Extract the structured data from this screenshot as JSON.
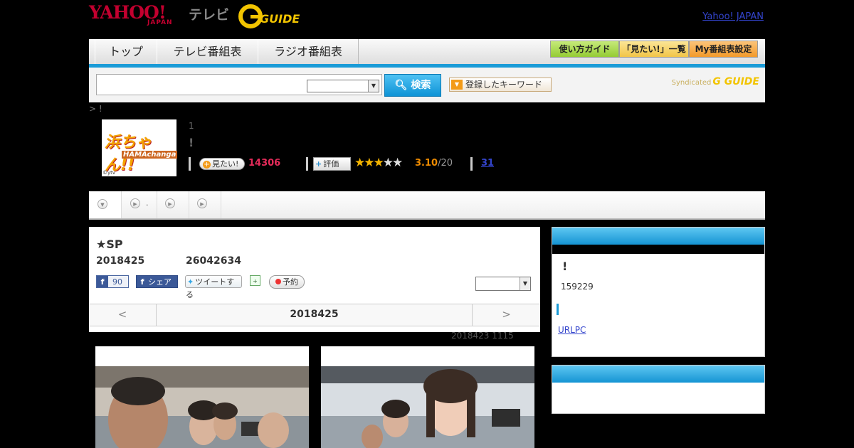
{
  "header": {
    "yahoo_logo": "YAHOO!",
    "yahoo_sub": "JAPAN",
    "tv_label": "テレビ",
    "gguide_logo": "G GUIDE",
    "yahoo_japan_link": "Yahoo! JAPAN"
  },
  "nav": {
    "tabs": [
      {
        "label": "トップ"
      },
      {
        "label": "テレビ番組表"
      },
      {
        "label": "ラジオ番組表"
      }
    ],
    "buttons": [
      {
        "label": "使い方ガイド",
        "color": "#a8d84a"
      },
      {
        "label": "「見たい!」一覧",
        "color": "#f7d060"
      },
      {
        "label": "My番組表設定",
        "color": "#f4a838"
      }
    ]
  },
  "search": {
    "placeholder": "",
    "button_label": "検索",
    "keyword_button": "登録したキーワード",
    "syndicated": "Syndicated",
    "syndicated_logo": "G GUIDE"
  },
  "breadcrumb": "> !",
  "program": {
    "thumb_title": "浜ちゃん!!",
    "thumb_sub": "HAMAchanga",
    "thumb_copyright": "©ytv",
    "number": "1",
    "title": "!",
    "want_label": "見たい!",
    "want_count": "14306",
    "eval_label": "評価",
    "rating_score": 3.1,
    "rating": "3.10",
    "rating_total": "/20",
    "review_count": "31"
  },
  "subtabs": [
    {
      "label": ""
    },
    {
      "label": "."
    },
    {
      "label": ""
    },
    {
      "label": ""
    }
  ],
  "episode": {
    "title": "★SP",
    "date": "2018425",
    "time": "26042634",
    "fb_like_count": "90",
    "fb_share": "シェア",
    "tweet": "ツイートする",
    "reserve": "予約",
    "date_nav": {
      "prev": "<",
      "current": "2018425",
      "next": ">"
    },
    "updated": "2018423  1115"
  },
  "sidebar": {
    "title": "!",
    "number": "159229",
    "link": "URLPC"
  },
  "colors": {
    "accent": "#1a9bd7",
    "want": "#e62b5a",
    "rating": "#f08c00",
    "link": "#3344cc"
  }
}
